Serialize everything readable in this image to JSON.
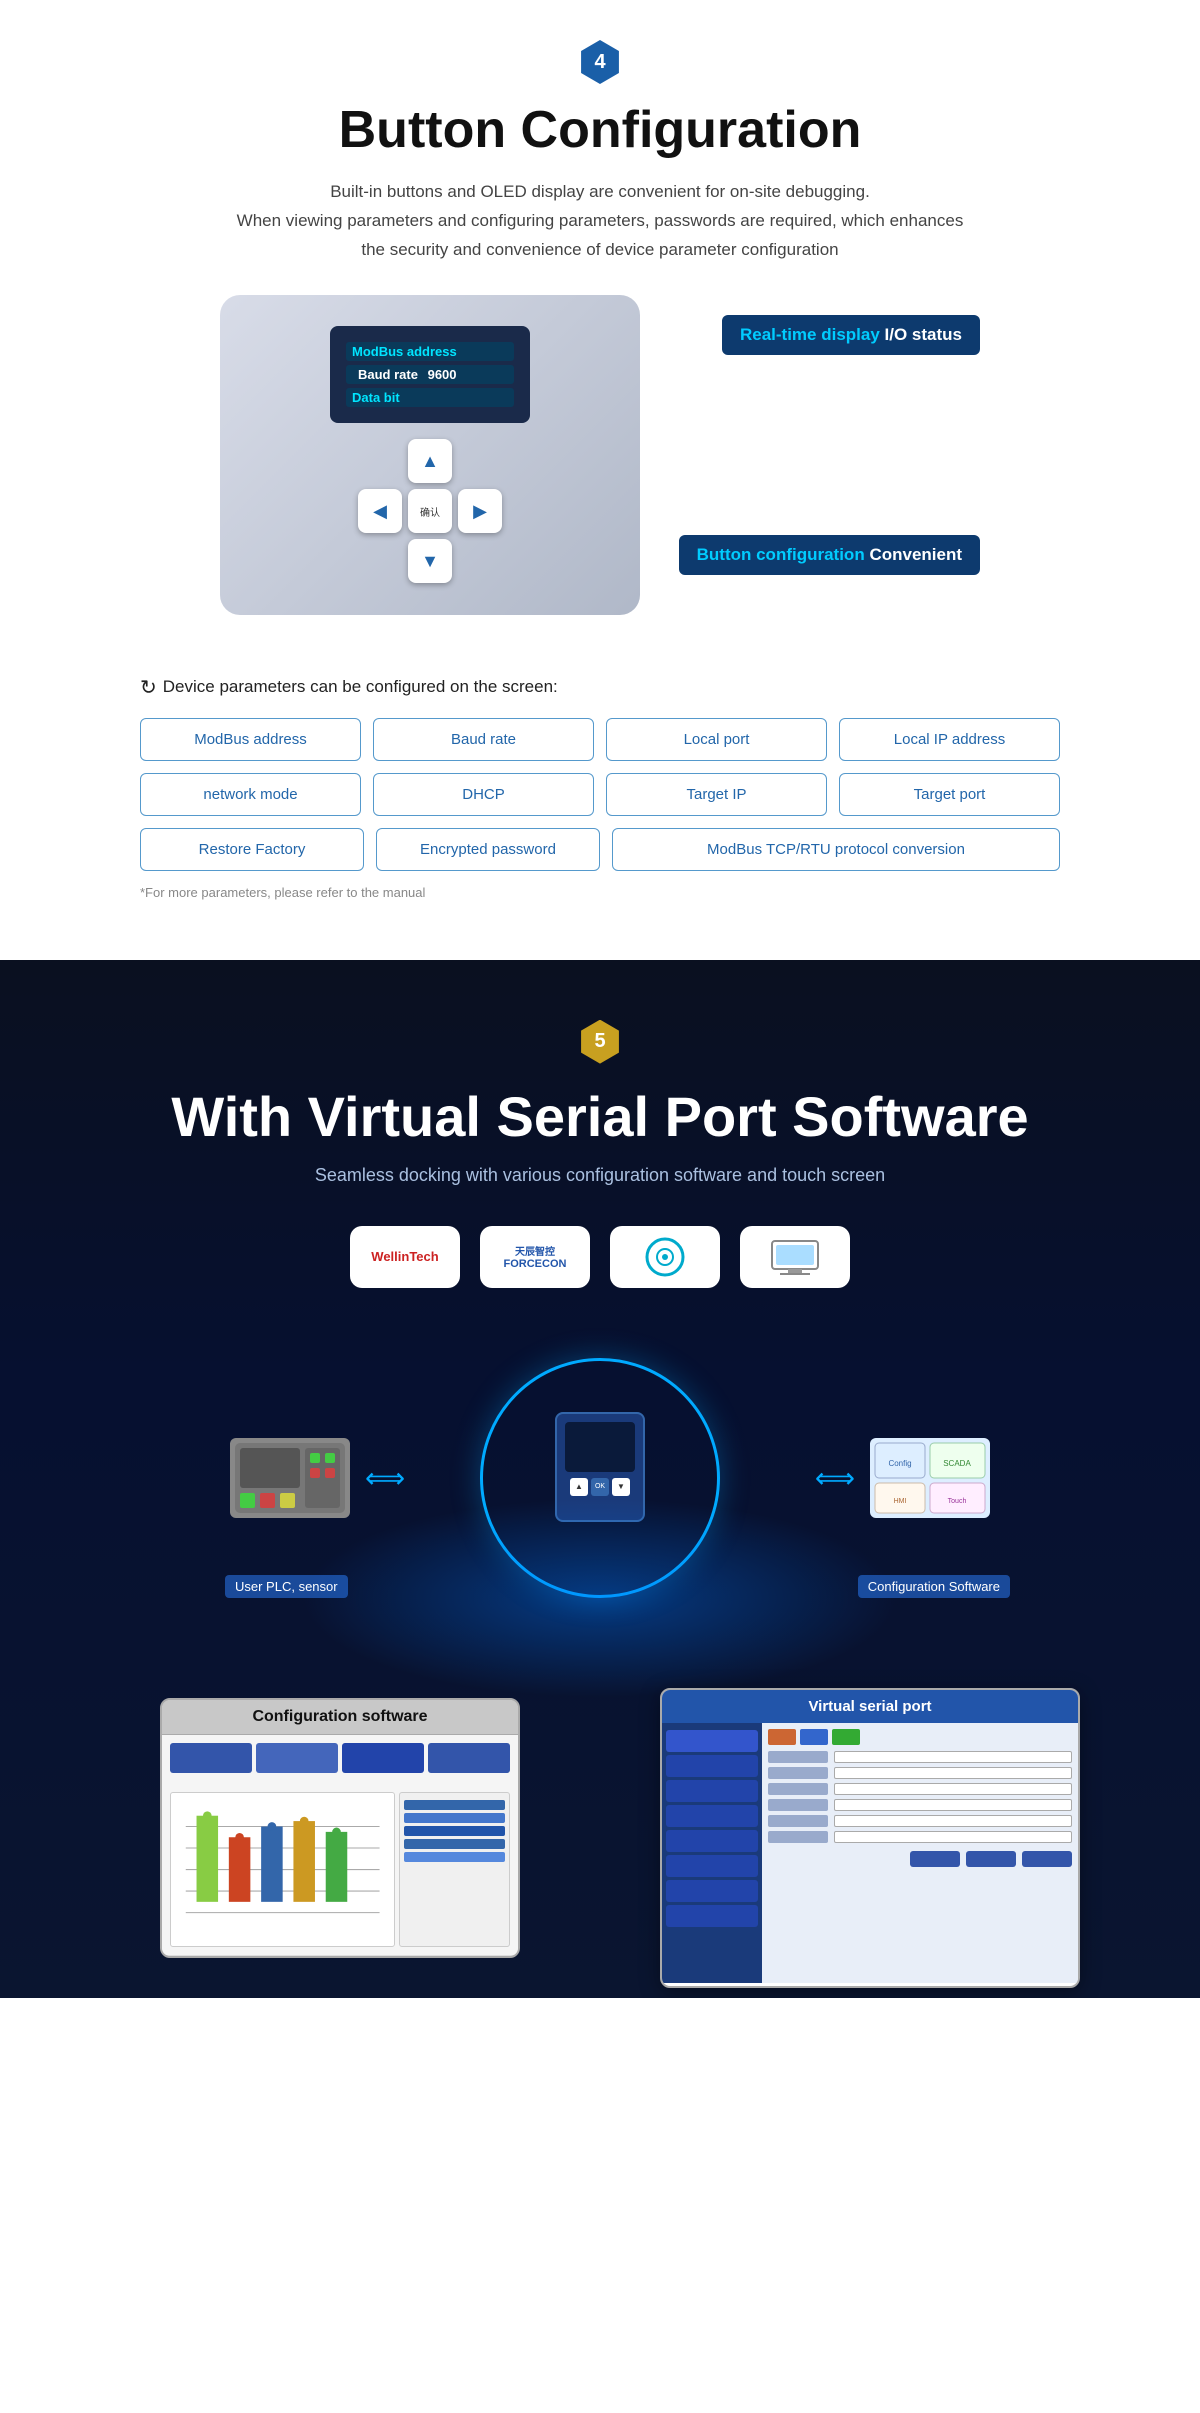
{
  "section4": {
    "badge": "4",
    "title": "Button Configuration",
    "subtitle_line1": "Built-in buttons and OLED display are convenient for on-site debugging.",
    "subtitle_line2": "When viewing parameters and configuring parameters, passwords are required, which enhances",
    "subtitle_line3": "the security and convenience of device parameter configuration",
    "callout_top": "Real-time display I/O status",
    "callout_top_normal": "I/O status",
    "callout_top_highlight": "Real-time display",
    "callout_bottom_highlight": "Button configuration",
    "callout_bottom_normal": "Convenient",
    "device_screen": {
      "row1": "ModBus address",
      "row2_label": "Baud rate",
      "row2_value": "9600",
      "row3": "Data bit"
    },
    "params_header": "Device parameters can be configured on the screen:",
    "params": [
      "ModBus address",
      "Baud rate",
      "Local port",
      "Local IP address",
      "network mode",
      "DHCP",
      "Target IP",
      "Target port"
    ],
    "params_row3": [
      "Restore Factory",
      "Encrypted password",
      "ModBus TCP/RTU protocol conversion"
    ],
    "params_note": "*For more parameters, please refer to the manual"
  },
  "section5": {
    "badge": "5",
    "title": "With Virtual Serial Port Software",
    "subtitle": "Seamless docking with various configuration software and touch screen",
    "logos": [
      {
        "name": "WellinTech",
        "text": "WellinTech"
      },
      {
        "name": "FORCECON",
        "cn": "天辰智控",
        "en": "FORCECON"
      },
      {
        "name": "logo3",
        "text": "◎"
      },
      {
        "name": "logo4",
        "text": "⬜"
      }
    ],
    "label_plc": "User PLC, sensor",
    "label_config": "Configuration Software",
    "screenshot_config_title": "Configuration software",
    "screenshot_virtual_title": "Virtual serial port"
  }
}
